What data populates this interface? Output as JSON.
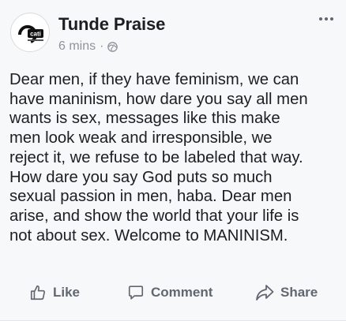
{
  "post": {
    "author": "Tunde Praise",
    "time": "6 mins",
    "separator": "·",
    "audience_icon": "globe-icon",
    "more_icon": "ellipsis-icon",
    "avatar_icon": "brand-logo-icon",
    "avatar_text": "cati",
    "text": "Dear men, if they have feminism, we can\nhave maninism, how dare you say all men\nwants is sex, messages like this make\nmen look weak and irresponsible, we\nreject it, we refuse to be labeled that way.\nHow dare you say God puts so much\nsexual passion in men, haba. Dear men\narise, and show the world that your life is\nnot about sex. Welcome to MANINISM."
  },
  "actions": {
    "like": {
      "label": "Like",
      "icon": "thumbs-up-icon"
    },
    "comment": {
      "label": "Comment",
      "icon": "speech-bubble-icon"
    },
    "share": {
      "label": "Share",
      "icon": "share-arrow-icon"
    }
  },
  "colors": {
    "background": "#f7f8fa",
    "text": "#1c1e21",
    "secondary": "#8d949e",
    "action": "#606770"
  }
}
